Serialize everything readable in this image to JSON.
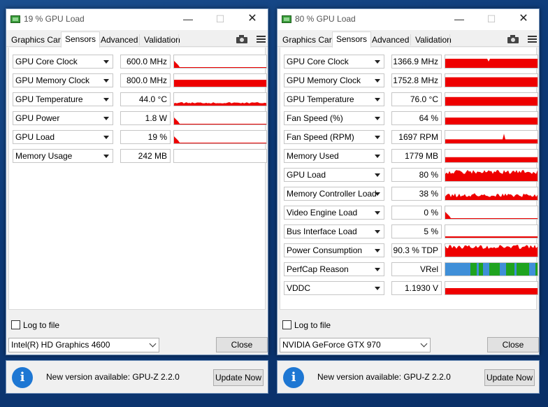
{
  "colors": {
    "graph_fill": "#ee0000",
    "perfcap_green": "#1fa31f",
    "perfcap_blue": "#3f8fd8",
    "info": "#1e77d3"
  },
  "icons": {
    "app": "gpu-card-icon",
    "minimize": "minimize-icon",
    "maximize": "maximize-icon",
    "close": "close-icon",
    "screenshot": "camera-icon",
    "menu": "hamburger-menu-icon",
    "info": "info-icon",
    "dropdown": "chevron-down-icon"
  },
  "windows": [
    {
      "title": "19 % GPU Load",
      "tabs": [
        {
          "label": "Graphics Card",
          "active": false
        },
        {
          "label": "Sensors",
          "active": true
        },
        {
          "label": "Advanced",
          "active": false
        },
        {
          "label": "Validation",
          "active": false
        }
      ],
      "window_controls": {
        "minimize": "—",
        "maximize": "☐",
        "close": "✕"
      },
      "sensors": [
        {
          "name": "GPU Core Clock",
          "value": "600.0 MHz",
          "graph": {
            "level": 0.03,
            "pattern": "spike-early"
          }
        },
        {
          "name": "GPU Memory Clock",
          "value": "800.0 MHz",
          "graph": {
            "level": 0.55,
            "pattern": "flat"
          }
        },
        {
          "name": "GPU Temperature",
          "value": "44.0 °C",
          "graph": {
            "level": 0.22,
            "pattern": "temp"
          }
        },
        {
          "name": "GPU Power",
          "value": "1.8 W",
          "graph": {
            "level": 0.05,
            "pattern": "spike-early"
          }
        },
        {
          "name": "GPU Load",
          "value": "19 %",
          "graph": {
            "level": 0.06,
            "pattern": "spike-early"
          }
        },
        {
          "name": "Memory Usage",
          "value": "242 MB",
          "graph": {
            "level": 0.0,
            "pattern": "empty"
          }
        }
      ],
      "log_to_file": {
        "label": "Log to file",
        "checked": false
      },
      "gpu_select": "Intel(R) HD Graphics 4600",
      "close_label": "Close"
    },
    {
      "title": "80 % GPU Load",
      "tabs": [
        {
          "label": "Graphics Card",
          "active": false
        },
        {
          "label": "Sensors",
          "active": true
        },
        {
          "label": "Advanced",
          "active": false
        },
        {
          "label": "Validation",
          "active": false
        }
      ],
      "window_controls": {
        "minimize": "—",
        "maximize": "☐",
        "close": "✕"
      },
      "sensors": [
        {
          "name": "GPU Core Clock",
          "value": "1366.9 MHz",
          "graph": {
            "level": 0.72,
            "pattern": "flat-dip"
          }
        },
        {
          "name": "GPU Memory Clock",
          "value": "1752.8 MHz",
          "graph": {
            "level": 0.75,
            "pattern": "flat"
          }
        },
        {
          "name": "GPU Temperature",
          "value": "76.0 °C",
          "graph": {
            "level": 0.68,
            "pattern": "flat"
          }
        },
        {
          "name": "Fan Speed (%)",
          "value": "64 %",
          "graph": {
            "level": 0.55,
            "pattern": "flat"
          }
        },
        {
          "name": "Fan Speed (RPM)",
          "value": "1697 RPM",
          "graph": {
            "level": 0.32,
            "pattern": "flat-spike"
          }
        },
        {
          "name": "Memory Used",
          "value": "1779 MB",
          "graph": {
            "level": 0.4,
            "pattern": "flat"
          }
        },
        {
          "name": "GPU Load",
          "value": "80 %",
          "graph": {
            "level": 0.72,
            "pattern": "noisy"
          }
        },
        {
          "name": "Memory Controller Load",
          "value": "38 %",
          "graph": {
            "level": 0.38,
            "pattern": "noisy"
          }
        },
        {
          "name": "Video Engine Load",
          "value": "0 %",
          "graph": {
            "level": 0.0,
            "pattern": "spike-early"
          }
        },
        {
          "name": "Bus Interface Load",
          "value": "5 %",
          "graph": {
            "level": 0.05,
            "pattern": "line"
          }
        },
        {
          "name": "Power Consumption",
          "value": "90.3 % TDP",
          "graph": {
            "level": 0.78,
            "pattern": "noisy"
          }
        },
        {
          "name": "PerfCap Reason",
          "value": "VRel",
          "graph": {
            "level": 1.0,
            "pattern": "perfcap"
          }
        },
        {
          "name": "VDDC",
          "value": "1.1930 V",
          "graph": {
            "level": 0.5,
            "pattern": "flat"
          }
        }
      ],
      "log_to_file": {
        "label": "Log to file",
        "checked": false
      },
      "gpu_select": "NVIDIA GeForce GTX 970",
      "close_label": "Close"
    }
  ],
  "notifications": [
    {
      "message": "New version available: GPU-Z 2.2.0",
      "button": "Update Now",
      "icon_glyph": "i"
    },
    {
      "message": "New version available: GPU-Z 2.2.0",
      "button": "Update Now",
      "icon_glyph": "i"
    }
  ]
}
